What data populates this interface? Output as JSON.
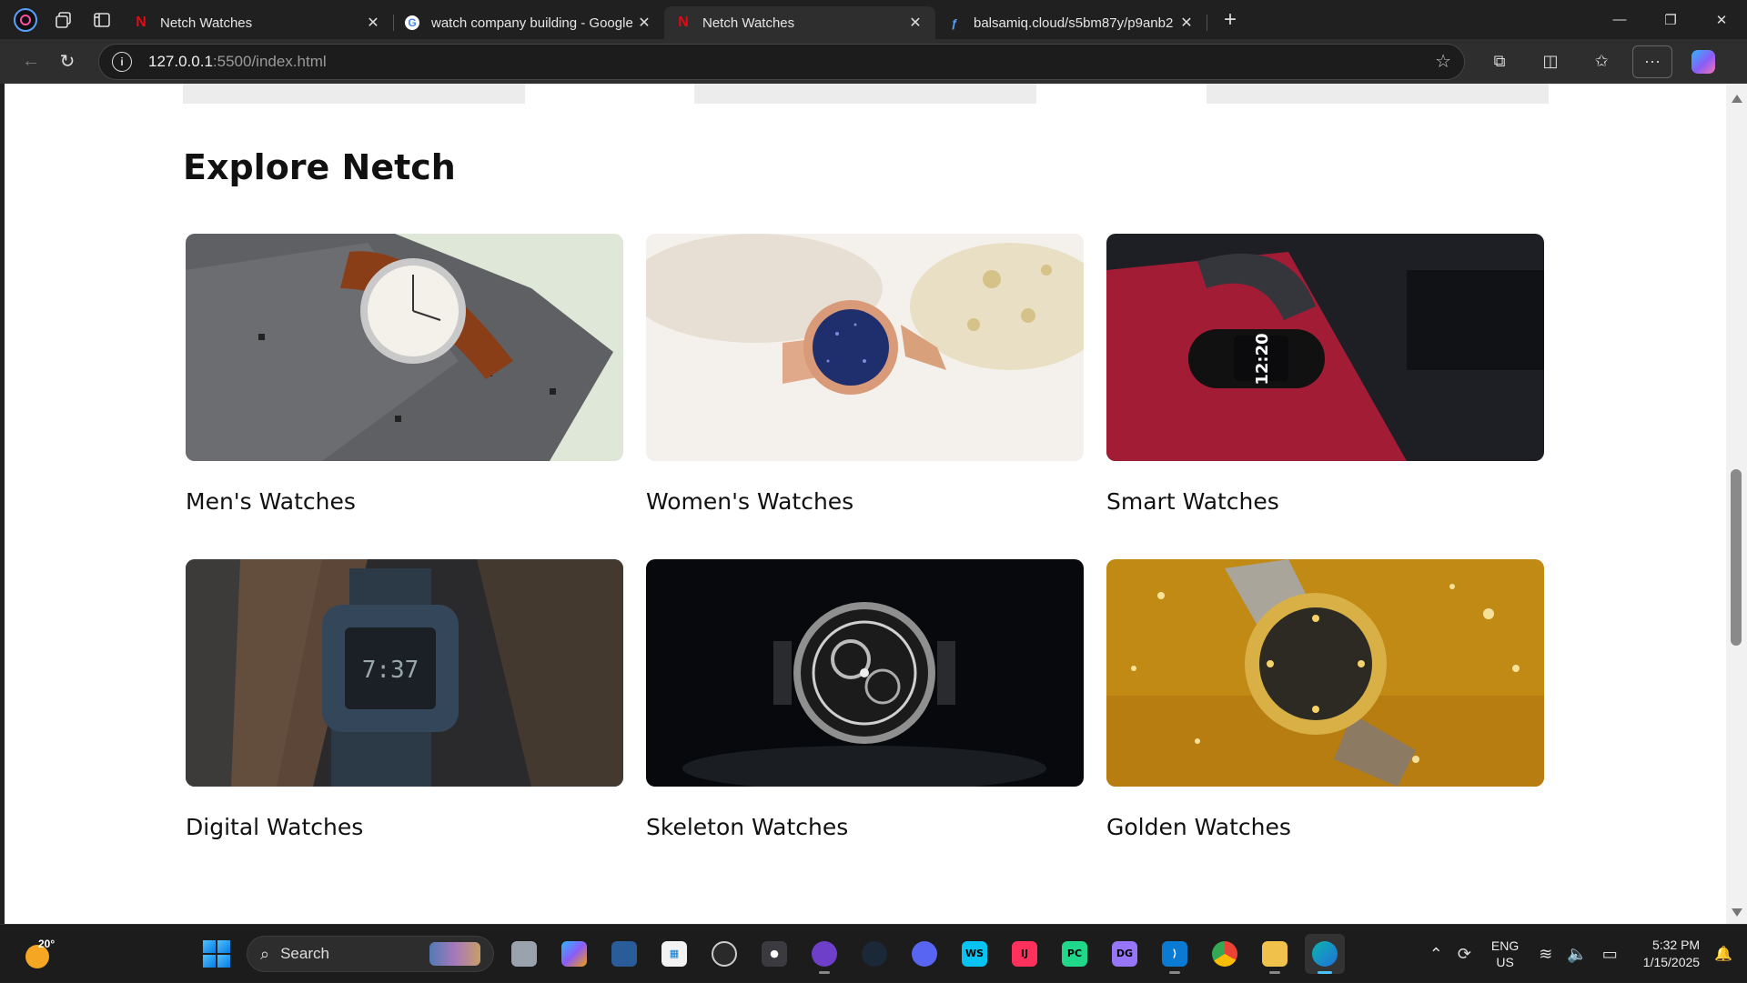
{
  "browser": {
    "tabs": [
      {
        "title": "Netch Watches",
        "favicon": "netflix-icon",
        "active": false
      },
      {
        "title": "watch company building - Google",
        "favicon": "google-icon",
        "active": false
      },
      {
        "title": "Netch Watches",
        "favicon": "netflix-icon",
        "active": true
      },
      {
        "title": "balsamiq.cloud/s5bm87y/p9anb2",
        "favicon": "balsamiq-icon",
        "active": false
      }
    ],
    "new_tab": "+",
    "url_host": "127.0.0.1",
    "url_rest": ":5500/index.html"
  },
  "page": {
    "heading": "Explore Netch",
    "categories": [
      {
        "label": "Men's Watches",
        "image": "classic-watch-on-grey-tie"
      },
      {
        "label": "Women's Watches",
        "image": "rose-gold-watch-blue-dial"
      },
      {
        "label": "Smart Watches",
        "image": "black-fitness-band-on-red"
      },
      {
        "label": "Digital Watches",
        "image": "dark-digital-watch-on-strap"
      },
      {
        "label": "Skeleton Watches",
        "image": "skeleton-watch-dark"
      },
      {
        "label": "Golden Watches",
        "image": "gold-watch-glitter"
      }
    ]
  },
  "taskbar": {
    "weather_temp": "20°",
    "search_placeholder": "Search",
    "apps": [
      "file-explorer-icon",
      "copilot-icon",
      "remote-desktop-icon",
      "microsoft-store-icon",
      "obs-icon",
      "davinci-icon",
      "github-icon",
      "steam-icon",
      "discord-icon",
      "webstorm-icon",
      "intellij-icon",
      "pycharm-icon",
      "datagrip-icon",
      "vscode-icon",
      "chrome-icon",
      "folder-icon",
      "edge-icon"
    ],
    "lang_top": "ENG",
    "lang_bottom": "US",
    "time": "5:32 PM",
    "date": "1/15/2025"
  },
  "colors": {
    "page_bg": "#ffffff",
    "chrome_bg": "#202020",
    "accent": "#4cc2ff"
  }
}
